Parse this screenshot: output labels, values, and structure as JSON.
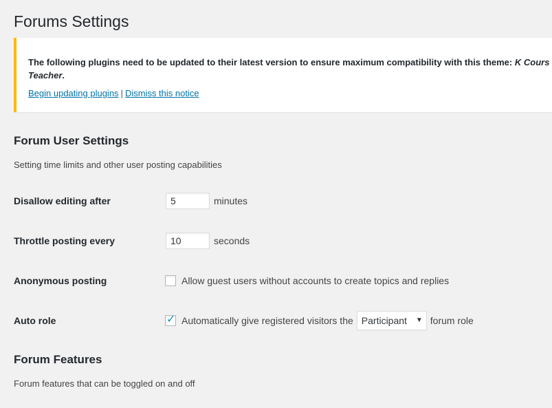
{
  "page": {
    "title": "Forums Settings"
  },
  "notice": {
    "text_before": "The following plugins need to be updated to their latest version to ensure maximum compatibility with this theme: ",
    "plugin_name_line1": "K Cours",
    "plugin_name_line2": "Teacher",
    "text_after": ".",
    "update_link": "Begin updating plugins",
    "separator": "|",
    "dismiss_link": "Dismiss this notice",
    "accent_color": "#ffb900"
  },
  "user_settings": {
    "heading": "Forum User Settings",
    "description": "Setting time limits and other user posting capabilities",
    "rows": {
      "edit_lock": {
        "label": "Disallow editing after",
        "value": "5",
        "unit": "minutes"
      },
      "throttle": {
        "label": "Throttle posting every",
        "value": "10",
        "unit": "seconds"
      },
      "anonymous": {
        "label": "Anonymous posting",
        "checked": false,
        "text": "Allow guest users without accounts to create topics and replies"
      },
      "auto_role": {
        "label": "Auto role",
        "checked": true,
        "text_before": "Automatically give registered visitors the",
        "selected_role": "Participant",
        "text_after": "forum role"
      }
    }
  },
  "features": {
    "heading": "Forum Features",
    "description": "Forum features that can be toggled on and off"
  },
  "colors": {
    "background": "#f1f1f1",
    "link": "#0073aa",
    "check": "#1e8cbe"
  }
}
